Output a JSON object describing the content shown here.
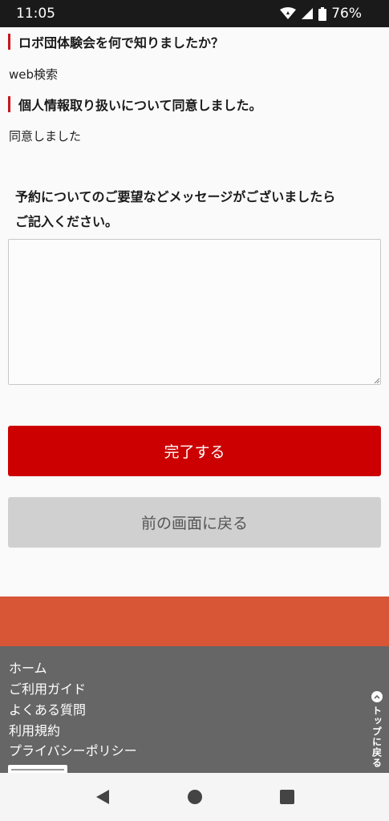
{
  "status_bar": {
    "time": "11:05",
    "battery": "76%",
    "icons": [
      "wifi-icon",
      "signal-icon",
      "battery-icon"
    ]
  },
  "form": {
    "q1_heading": "ロボ団体験会を何で知りましたか？",
    "q1_answer": "web検索",
    "q2_heading": "個人情報取り扱いについて同意しました。",
    "q2_answer": "同意しました",
    "message_prompt_line1": "予約についてのご要望などメッセージがございましたら",
    "message_prompt_line2": "ご記入ください。",
    "message_value": ""
  },
  "buttons": {
    "complete": "完了する",
    "back": "前の画面に戻る"
  },
  "footer": {
    "links": [
      "ホーム",
      "ご利用ガイド",
      "よくある質問",
      "利用規約",
      "プライバシーポリシー"
    ],
    "to_top": "トップに戻る"
  },
  "colors": {
    "accent_red": "#cc0000",
    "footer_band": "#d85536",
    "footer_bg": "#666666"
  }
}
